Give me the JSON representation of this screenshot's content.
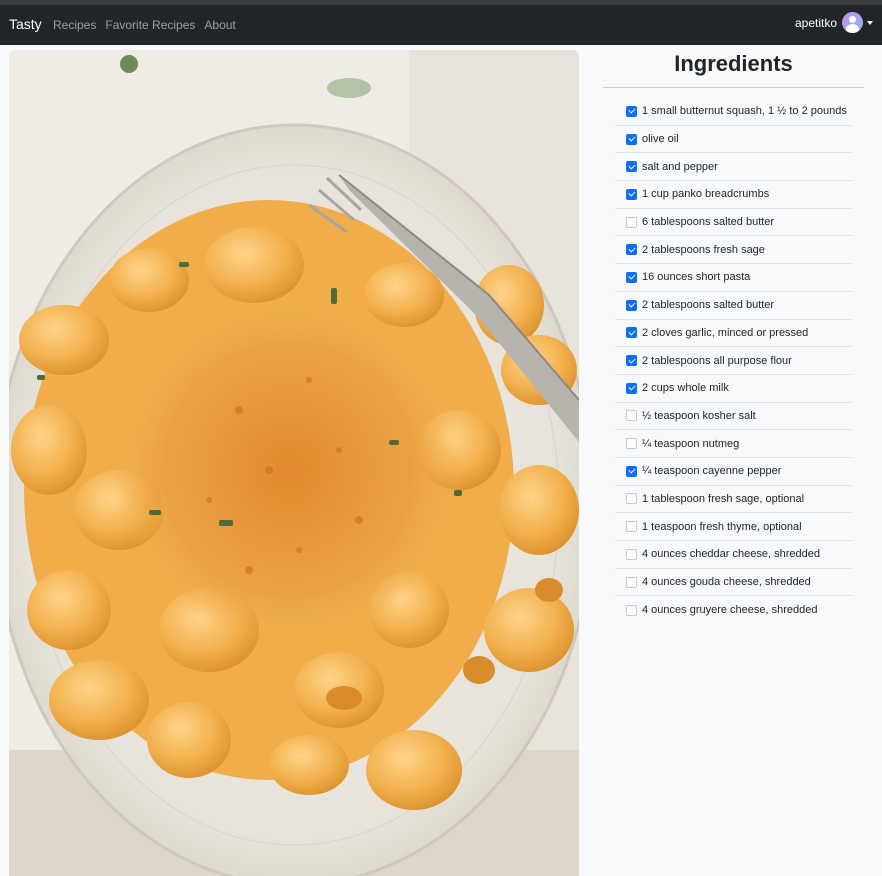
{
  "navbar": {
    "brand": "Tasty",
    "links": [
      {
        "label": "Recipes"
      },
      {
        "label": "Favorite Recipes"
      },
      {
        "label": "About"
      }
    ],
    "user": {
      "name": "apetitko",
      "avatar_icon": "user-avatar-icon",
      "menu_icon": "caret-down-icon"
    }
  },
  "recipe": {
    "image_description": "mac-and-cheese-photo"
  },
  "ingredients": {
    "title": "Ingredients",
    "items": [
      {
        "text": "1 small butternut squash, 1 ½ to 2 pounds",
        "checked": true
      },
      {
        "text": "olive oil",
        "checked": true
      },
      {
        "text": "salt and pepper",
        "checked": true
      },
      {
        "text": "1 cup panko breadcrumbs",
        "checked": true
      },
      {
        "text": "6 tablespoons salted butter",
        "checked": false
      },
      {
        "text": "2 tablespoons fresh sage",
        "checked": true
      },
      {
        "text": "16 ounces short pasta",
        "checked": true
      },
      {
        "text": "2 tablespoons salted butter",
        "checked": true
      },
      {
        "text": "2 cloves garlic, minced or pressed",
        "checked": true
      },
      {
        "text": "2 tablespoons all purpose flour",
        "checked": true
      },
      {
        "text": "2 cups whole milk",
        "checked": true
      },
      {
        "text": "½ teaspoon kosher salt",
        "checked": false
      },
      {
        "text": "¼ teaspoon nutmeg",
        "checked": false
      },
      {
        "text": "¼ teaspoon cayenne pepper",
        "checked": true
      },
      {
        "text": "1 tablespoon fresh sage, optional",
        "checked": false
      },
      {
        "text": "1 teaspoon fresh thyme, optional",
        "checked": false
      },
      {
        "text": "4 ounces cheddar cheese, shredded",
        "checked": false
      },
      {
        "text": "4 ounces gouda cheese, shredded",
        "checked": false
      },
      {
        "text": "4 ounces gruyere cheese, shredded",
        "checked": false
      }
    ]
  },
  "colors": {
    "navbar_bg": "#212529",
    "accent": "#0d6efd",
    "page_bg": "#f8f9fa"
  }
}
